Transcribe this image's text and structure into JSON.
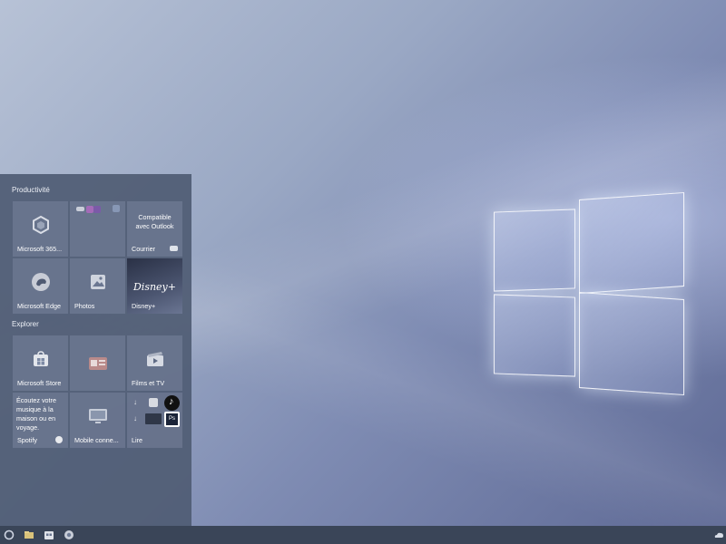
{
  "start_menu": {
    "groups": [
      {
        "title": "Productivité"
      },
      {
        "title": "Explorer"
      }
    ],
    "tiles": {
      "m365": {
        "label": "Microsoft 365..."
      },
      "courrier": {
        "text": "Compatible avec Outlook",
        "label": "Courrier"
      },
      "edge": {
        "label": "Microsoft Edge"
      },
      "photos": {
        "label": "Photos"
      },
      "disney": {
        "label": "Disney+",
        "logo": "Disney+"
      },
      "store": {
        "label": "Microsoft Store"
      },
      "films": {
        "label": "Films et TV"
      },
      "spotify": {
        "text": "Écoutez votre musique à la maison ou en voyage.",
        "label": "Spotify"
      },
      "mobile": {
        "label": "Mobile conne..."
      },
      "lire": {
        "label": "Lire",
        "ps": "Ps"
      }
    }
  },
  "colors": {
    "accent": "#505c74",
    "taskbar": "#3a4558"
  }
}
